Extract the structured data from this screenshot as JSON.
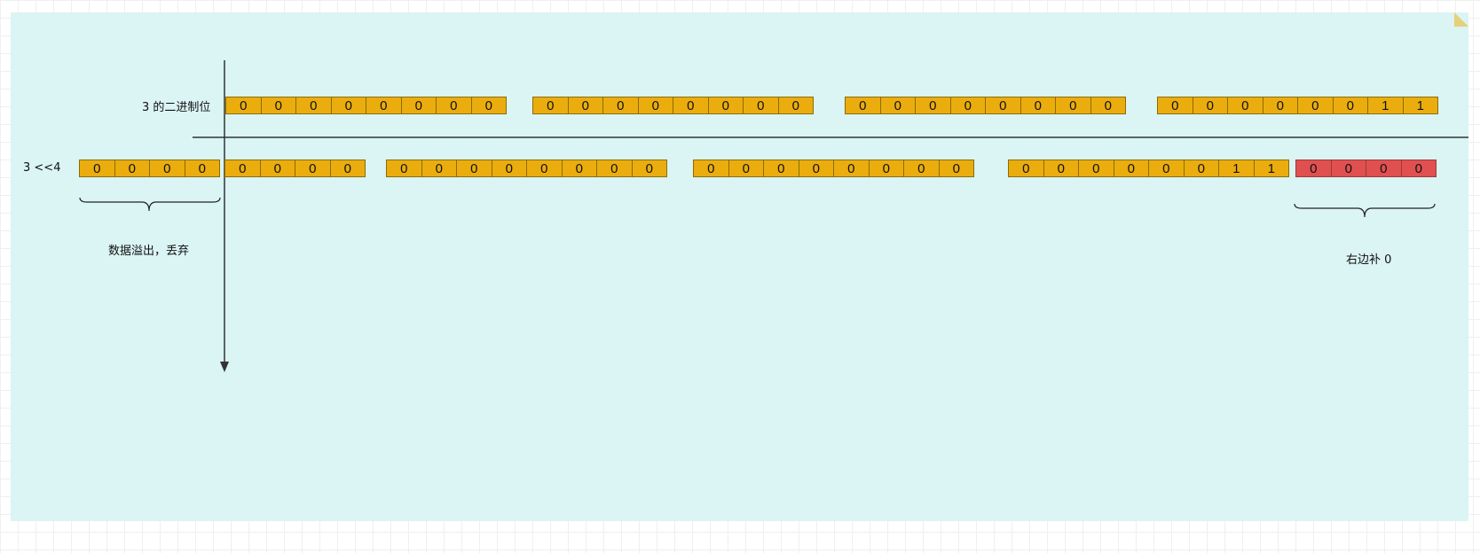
{
  "labels": {
    "binary_of_3": "3 的二进制位",
    "shift_expr": "3 <<4",
    "overflow_note": "数据溢出，丢弃",
    "pad_note": "右边补 0"
  },
  "original_bytes": [
    [
      "0",
      "0",
      "0",
      "0",
      "0",
      "0",
      "0",
      "0"
    ],
    [
      "0",
      "0",
      "0",
      "0",
      "0",
      "0",
      "0",
      "0"
    ],
    [
      "0",
      "0",
      "0",
      "0",
      "0",
      "0",
      "0",
      "0"
    ],
    [
      "0",
      "0",
      "0",
      "0",
      "0",
      "0",
      "1",
      "1"
    ]
  ],
  "overflow_bits": [
    "0",
    "0",
    "0",
    "0"
  ],
  "shifted_groups": [
    [
      "0",
      "0",
      "0",
      "0"
    ],
    [
      "0",
      "0",
      "0",
      "0",
      "0",
      "0",
      "0",
      "0"
    ],
    [
      "0",
      "0",
      "0",
      "0",
      "0",
      "0",
      "0",
      "0"
    ],
    [
      "0",
      "0",
      "0",
      "0",
      "0",
      "0",
      "1",
      "1"
    ]
  ],
  "padding_bits": [
    "0",
    "0",
    "0",
    "0"
  ],
  "colors": {
    "panel": "#dbf4f4",
    "bit_fill": "#ebad0e",
    "pad_fill": "#e05050",
    "line": "#333333"
  }
}
